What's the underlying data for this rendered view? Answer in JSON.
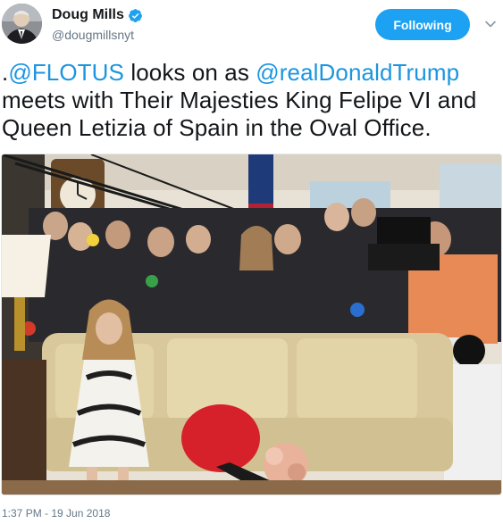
{
  "author": {
    "name": "Doug Mills",
    "handle": "@dougmillsnyt",
    "verified": true,
    "avatar_icon": "profile-photo-icon"
  },
  "follow_button": {
    "label": "Following",
    "color": "#1da1f2"
  },
  "menu": {
    "icon": "chevron-down-icon"
  },
  "tweet": {
    "prefix": ".",
    "mention1": "@FLOTUS",
    "middle": " looks on as ",
    "mention2": "@realDonaldTrump",
    "rest": " meets with Their Majesties King Felipe VI and Queen Letizia of Spain in the Oval Office.",
    "link_color": "#1b95e0"
  },
  "photo": {
    "icon": "tweet-photo-image"
  },
  "timestamp": "1:37 PM - 19 Jun 2018"
}
